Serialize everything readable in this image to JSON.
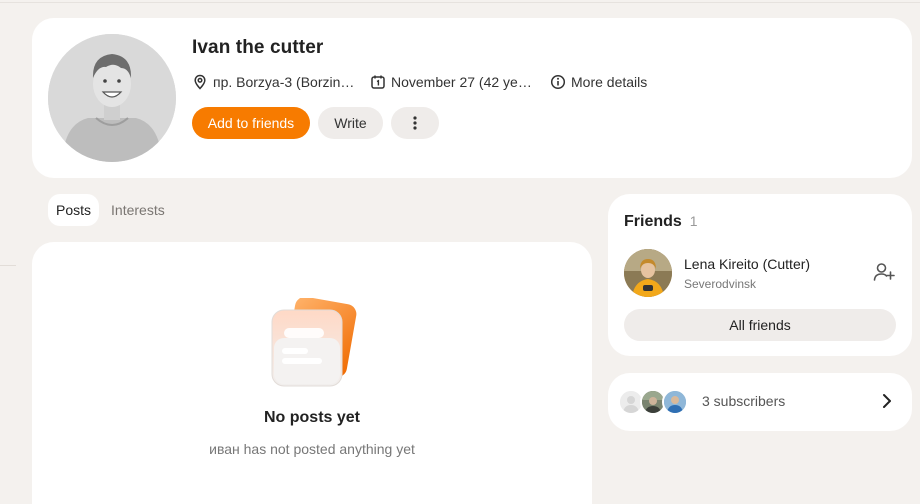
{
  "profile": {
    "name": "Ivan the cutter",
    "location": "пр. Borzya-3 (Borzinsky district)",
    "birthday": "November 27 (42 years)",
    "more_details": "More details",
    "add_friends_label": "Add to friends",
    "write_label": "Write"
  },
  "tabs": [
    {
      "label": "Posts",
      "active": true
    },
    {
      "label": "Interests",
      "active": false
    }
  ],
  "feed": {
    "empty_title": "No posts yet",
    "empty_subtitle": "иван has not posted anything yet"
  },
  "friends": {
    "title": "Friends",
    "count": "1",
    "items": [
      {
        "name": "Lena Kireito (Cutter)",
        "city": "Severodvinsk"
      }
    ],
    "all_friends_label": "All friends"
  },
  "subscribers": {
    "label": "3 subscribers"
  },
  "colors": {
    "accent": "#f77b00",
    "background": "#f4f1ee",
    "card": "#ffffff",
    "secondary_button": "#efecea"
  },
  "icons": [
    "location-pin-icon",
    "calendar-icon",
    "info-icon",
    "more-vertical-icon",
    "add-friend-icon",
    "chevron-right-icon"
  ]
}
